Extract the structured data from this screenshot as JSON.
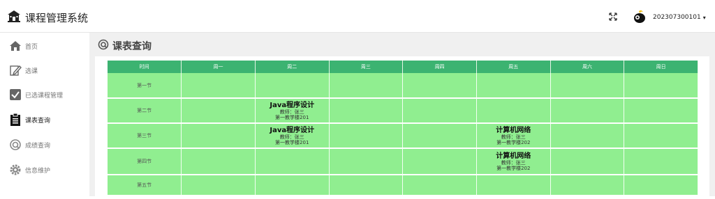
{
  "app": {
    "title": "课程管理系统"
  },
  "header": {
    "user_id": "202307300101",
    "caret": "▾"
  },
  "sidebar": {
    "items": [
      {
        "label": "首页",
        "icon": "home-icon"
      },
      {
        "label": "选课",
        "icon": "edit-icon"
      },
      {
        "label": "已选课程管理",
        "icon": "check-square-icon"
      },
      {
        "label": "课表查询",
        "icon": "clipboard-icon"
      },
      {
        "label": "成绩查询",
        "icon": "search-icon"
      },
      {
        "label": "信息维护",
        "icon": "gear-icon"
      }
    ],
    "active": "课表查询"
  },
  "page": {
    "title": "课表查询"
  },
  "timetable": {
    "headers": [
      "时间",
      "周一",
      "周二",
      "周三",
      "周四",
      "周五",
      "周六",
      "周日"
    ],
    "rows": [
      {
        "slot": "第一节",
        "cells": [
          null,
          null,
          null,
          null,
          null,
          null,
          null
        ]
      },
      {
        "slot": "第二节",
        "cells": [
          null,
          {
            "name": "Java程序设计",
            "teacher": "教师：张三",
            "room": "第一教学楼201"
          },
          null,
          null,
          null,
          null,
          null
        ]
      },
      {
        "slot": "第三节",
        "cells": [
          null,
          {
            "name": "Java程序设计",
            "teacher": "教师：张三",
            "room": "第一教学楼201"
          },
          null,
          null,
          {
            "name": "计算机网络",
            "teacher": "教师：张三",
            "room": "第一教学楼202"
          },
          null,
          null
        ]
      },
      {
        "slot": "第四节",
        "cells": [
          null,
          null,
          null,
          null,
          {
            "name": "计算机网络",
            "teacher": "教师：张三",
            "room": "第一教学楼202"
          },
          null,
          null
        ]
      },
      {
        "slot": "第五节",
        "cells": [
          null,
          null,
          null,
          null,
          null,
          null,
          null
        ]
      }
    ]
  },
  "colors": {
    "header_green": "#3cb371",
    "cell_green": "#90ee90"
  }
}
